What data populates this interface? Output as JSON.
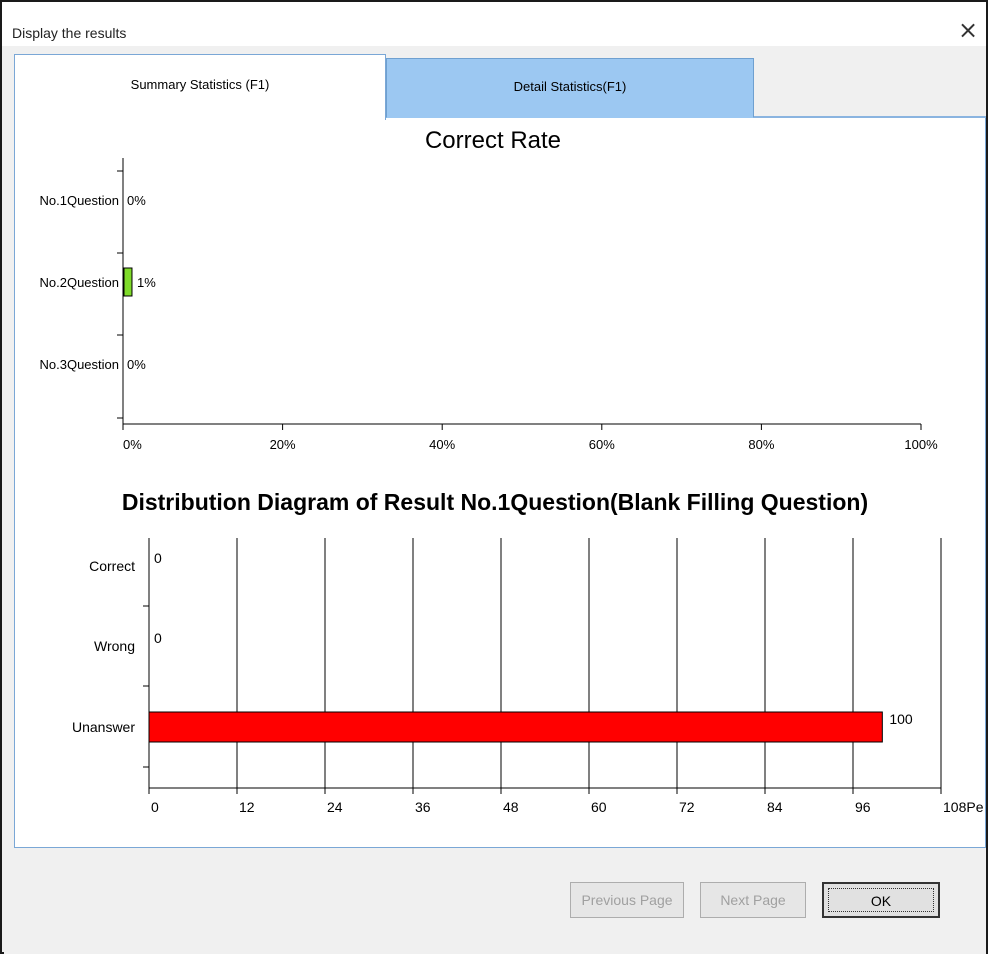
{
  "window": {
    "title": "Display the results",
    "close_icon": "close-x-icon"
  },
  "tabs": [
    {
      "label": "Summary Statistics (F1)",
      "active": true
    },
    {
      "label": "Detail Statistics(F1)",
      "active": false
    }
  ],
  "buttons": {
    "previous": "Previous Page",
    "next": "Next Page",
    "ok": "OK"
  },
  "colors": {
    "correct_rate_bar": "#7fdb2a",
    "unanswered_bar": "#ff0000",
    "active_tab": "#ffffff",
    "inactive_tab": "#9cc8f2"
  },
  "chart_data": [
    {
      "type": "bar",
      "orientation": "horizontal",
      "title": "Correct Rate",
      "categories": [
        "No.1Question",
        "No.2Question",
        "No.3Question"
      ],
      "values": [
        0,
        1,
        0
      ],
      "value_labels": [
        "0%",
        "1%",
        "0%"
      ],
      "xlim": [
        0,
        100
      ],
      "xticks": [
        "0%",
        "20%",
        "40%",
        "60%",
        "80%",
        "100%"
      ],
      "grid": false
    },
    {
      "type": "bar",
      "orientation": "horizontal",
      "title": "Distribution Diagram of Result No.1Question(Blank Filling Question)",
      "categories": [
        "Correct",
        "Wrong",
        "Unanswer"
      ],
      "values": [
        0,
        0,
        100
      ],
      "value_labels": [
        "0",
        "0",
        "100"
      ],
      "xlim": [
        0,
        108
      ],
      "xticks": [
        "0",
        "12",
        "24",
        "36",
        "48",
        "60",
        "72",
        "84",
        "96",
        "108Pe"
      ],
      "grid": true
    }
  ]
}
